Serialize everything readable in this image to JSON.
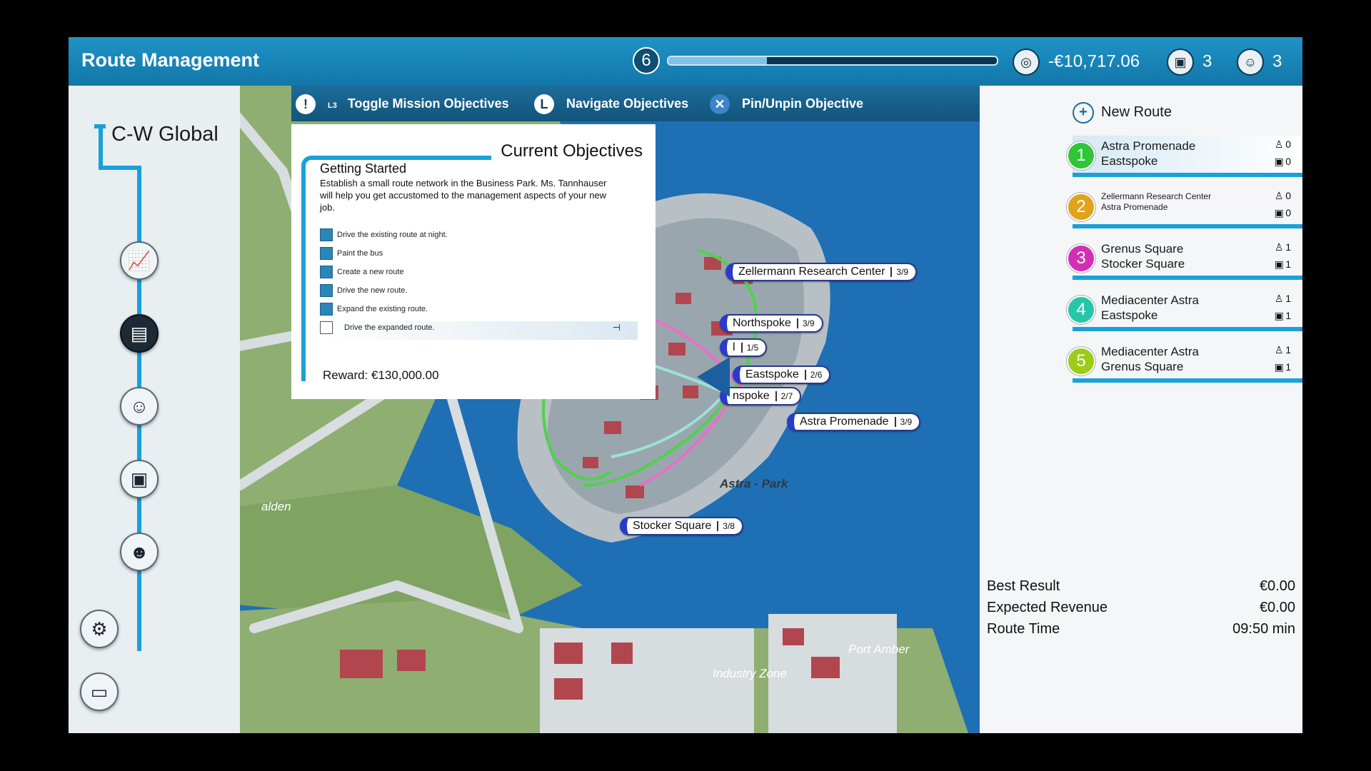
{
  "header": {
    "title": "Route Management",
    "level": "6",
    "progress": 0.3,
    "money": "-€10,717.06",
    "buses": "3",
    "drivers": "3",
    "money_icon": "coin-stack-icon",
    "bus_icon": "bus-icon",
    "driver_icon": "driver-icon"
  },
  "sidebar": {
    "company": "C-W Global",
    "buttons": [
      {
        "name": "statistics",
        "icon": "chart-icon"
      },
      {
        "name": "map",
        "icon": "map-icon"
      },
      {
        "name": "drivers",
        "icon": "driver-icon"
      },
      {
        "name": "buses",
        "icon": "bus-icon"
      },
      {
        "name": "passengers",
        "icon": "people-icon"
      },
      {
        "name": "settings",
        "icon": "gears-icon"
      },
      {
        "name": "monitor",
        "icon": "monitor-icon"
      }
    ]
  },
  "toolbar": {
    "toggle_label": "Toggle Mission Objectives",
    "toggle_key": "L3",
    "navigate_label": "Navigate Objectives",
    "navigate_key": "L",
    "pin_label": "Pin/Unpin Objective"
  },
  "objectives": {
    "title": "Current Objectives",
    "heading": "Getting Started",
    "description": "Establish a small route network in the Business Park. Ms. Tannhauser will help you get accustomed to the management aspects of your new job.",
    "items": [
      {
        "label": "Drive the existing route at night.",
        "done": true
      },
      {
        "label": "Paint the bus",
        "done": true
      },
      {
        "label": "Create a new route",
        "done": true
      },
      {
        "label": "Drive the new route.",
        "done": true
      },
      {
        "label": "Expand the existing route.",
        "done": true
      },
      {
        "label": "Drive the expanded route.",
        "done": false
      }
    ],
    "reward": "Reward: €130,000.00"
  },
  "map": {
    "labels": {
      "astra_park": "Astra - Park",
      "port_amber": "Port Amber",
      "industry_zone": "Industry Zone",
      "walden": "alden"
    },
    "stops": [
      {
        "name": "Zellermann Research Center",
        "count": "3/9"
      },
      {
        "name": "Northspoke",
        "count": "3/9"
      },
      {
        "name": "l",
        "count": "1/5"
      },
      {
        "name": "Eastspoke",
        "count": "2/6"
      },
      {
        "name": "nspoke",
        "count": "2/7"
      },
      {
        "name": "Astra Promenade",
        "count": "3/9"
      },
      {
        "name": "Stocker Square",
        "count": "3/8"
      }
    ]
  },
  "routes": {
    "new_route": "New Route",
    "list": [
      {
        "num": "1",
        "color": "#2fc63a",
        "from": "Astra Promenade",
        "to": "Eastspoke",
        "drivers": "0",
        "buses": "0"
      },
      {
        "num": "2",
        "color": "#e0a41a",
        "from": "Zellermann Research Center",
        "to": "Astra Promenade",
        "drivers": "0",
        "buses": "0"
      },
      {
        "num": "3",
        "color": "#d42fb4",
        "from": "Grenus Square",
        "to": "Stocker Square",
        "drivers": "1",
        "buses": "1"
      },
      {
        "num": "4",
        "color": "#27c6a8",
        "from": "Mediacenter Astra",
        "to": "Eastspoke",
        "drivers": "1",
        "buses": "1"
      },
      {
        "num": "5",
        "color": "#9ccc18",
        "from": "Mediacenter Astra",
        "to": "Grenus Square",
        "drivers": "1",
        "buses": "1"
      }
    ]
  },
  "stats": {
    "best_result_label": "Best Result",
    "best_result": "€0.00",
    "expected_revenue_label": "Expected Revenue",
    "expected_revenue": "€0.00",
    "route_time_label": "Route Time",
    "route_time": "09:50 min"
  }
}
